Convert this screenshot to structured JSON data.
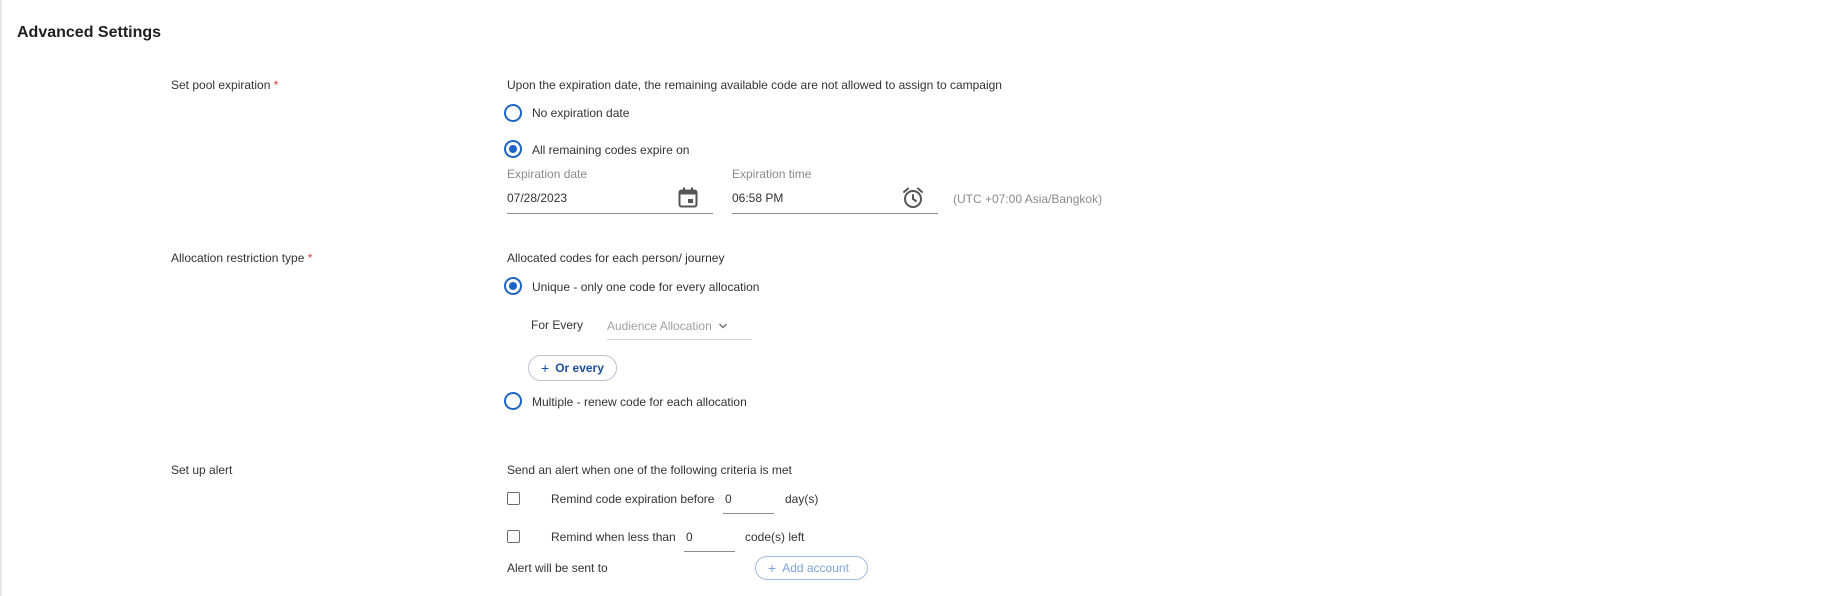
{
  "page": {
    "title": "Advanced Settings"
  },
  "pool_expiration": {
    "label": "Set pool expiration",
    "required_mark": "*",
    "description": "Upon the expiration date, the remaining available code are not allowed to assign to campaign",
    "option_none": "No expiration date",
    "option_expire": "All remaining codes expire on",
    "selected": "expire",
    "date_label": "Expiration date",
    "date_value": "07/28/2023",
    "time_label": "Expiration time",
    "time_value": "06:58 PM",
    "timezone": "(UTC +07:00 Asia/Bangkok)"
  },
  "allocation": {
    "label": "Allocation restriction type",
    "required_mark": "*",
    "description": "Allocated codes for each person/ journey",
    "option_unique": "Unique - only one code for every allocation",
    "option_multiple": "Multiple - renew code for each allocation",
    "selected": "unique",
    "for_every_label": "For Every",
    "for_every_select": "Audience Allocation",
    "or_every_button": "Or every"
  },
  "alert": {
    "label": "Set up alert",
    "description": "Send an alert when one of the following criteria is met",
    "remind_expiration_label": "Remind code expiration before",
    "remind_expiration_value": "0",
    "remind_expiration_unit": "day(s)",
    "remind_less_label": "Remind when less than",
    "remind_less_value": "0",
    "remind_less_unit": "code(s) left",
    "sent_to_label": "Alert will be sent to",
    "add_account_button": "Add account"
  },
  "colors": {
    "accent": "#1d63c5",
    "required": "#d83b3b",
    "button_text": "#1d4fa0"
  },
  "icons": {
    "calendar": "calendar-icon",
    "clock": "alarm-clock-icon",
    "chevron": "chevron-down-icon",
    "plus": "plus-icon"
  }
}
